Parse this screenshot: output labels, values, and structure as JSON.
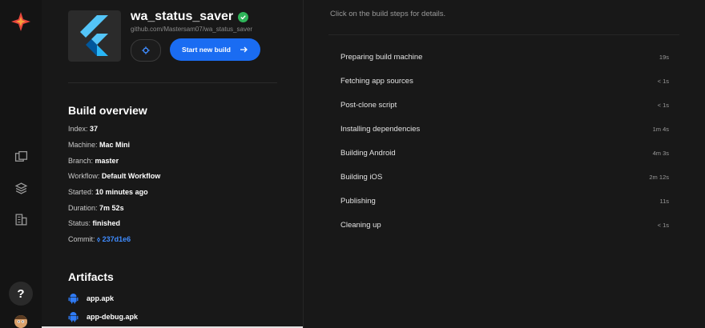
{
  "app": {
    "name": "wa_status_saver",
    "repo": "github.com/Mastersam07/wa_status_saver",
    "start_button": "Start new build"
  },
  "overview": {
    "title": "Build overview",
    "rows": [
      {
        "label": "Index:",
        "value": "37"
      },
      {
        "label": "Machine:",
        "value": "Mac Mini"
      },
      {
        "label": "Branch:",
        "value": "master"
      },
      {
        "label": "Workflow:",
        "value": "Default Workflow"
      },
      {
        "label": "Started:",
        "value": "10 minutes ago"
      },
      {
        "label": "Duration:",
        "value": "7m 52s"
      },
      {
        "label": "Status:",
        "value": "finished"
      }
    ],
    "commit_label": "Commit:",
    "commit_value": "⬨ 237d1e6"
  },
  "artifacts": {
    "title": "Artifacts",
    "items": [
      "app.apk",
      "app-debug.apk"
    ]
  },
  "help": "?",
  "main": {
    "hint": "Click on the build steps for details.",
    "steps": [
      {
        "name": "Preparing build machine",
        "time": "19s"
      },
      {
        "name": "Fetching app sources",
        "time": "< 1s"
      },
      {
        "name": "Post-clone script",
        "time": "< 1s"
      },
      {
        "name": "Installing dependencies",
        "time": "1m 4s"
      },
      {
        "name": "Building Android",
        "time": "4m 3s"
      },
      {
        "name": "Building iOS",
        "time": "2m 12s"
      },
      {
        "name": "Publishing",
        "time": "11s"
      },
      {
        "name": "Cleaning up",
        "time": "< 1s"
      }
    ]
  },
  "colors": {
    "accent": "#1a6cf2",
    "success": "#2fb55a",
    "brand": "#e8453c",
    "link": "#3f8cff"
  },
  "icons": [
    "codemagic-logo-icon",
    "apps-icon",
    "layers-icon",
    "billing-icon",
    "flutter-logo-icon",
    "verified-check-icon",
    "gear-icon",
    "arrow-right-icon",
    "android-icon"
  ]
}
